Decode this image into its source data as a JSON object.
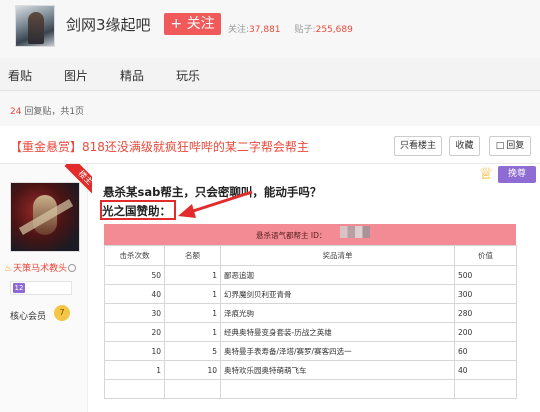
{
  "forum": {
    "name": "剑网3缘起吧",
    "follow_label": "+ 关注",
    "followers_label": "关注:",
    "followers": "37,881",
    "posts_label": "贴子:",
    "posts": "255,689"
  },
  "tabs": [
    "看贴",
    "图片",
    "精品",
    "玩乐"
  ],
  "reply_info": {
    "count": "24",
    "text": "回复贴，共1页"
  },
  "thread": {
    "title": "【重金悬赏】818还没满级就疯狂哔哔的某二字帮会帮主",
    "buttons": {
      "only_op": "只看楼主",
      "favorite": "收藏",
      "reply": "回复"
    }
  },
  "user": {
    "ribbon": "楼主",
    "name": "天策马术教头",
    "level_badge": "12",
    "member_label": "核心会员",
    "member_level": "7"
  },
  "post": {
    "promote_label": "挽尊",
    "line1": "悬杀某sab帮主，只会密聊叫，能动手吗？",
    "line2": "光之国赞助："
  },
  "prize_table": {
    "header": "悬杀语气都帮主 ID：",
    "columns": [
      "击杀次数",
      "名额",
      "奖品清单",
      "价值"
    ],
    "rows": [
      [
        "50",
        "1",
        "鄙恶追迦",
        "500"
      ],
      [
        "40",
        "1",
        "幻界魔剑贝利亚青骨",
        "300"
      ],
      [
        "30",
        "1",
        "泽痕光驹",
        "280"
      ],
      [
        "20",
        "1",
        "经典奥特曼变身套装-历战之英雄",
        "200"
      ],
      [
        "10",
        "5",
        "奥特曼手表寿备/泽塔/赛罗/赛客四选一",
        "60"
      ],
      [
        "1",
        "10",
        "奥特欢乐园奥特萌萌飞车",
        "40"
      ],
      [
        "",
        "",
        "",
        ""
      ]
    ]
  },
  "colors": {
    "accent": "#e94a3b",
    "follow_button": "#f05a5a",
    "table_header": "#f28b93",
    "annotation": "#e32b2b",
    "promote": "#8f6bd4"
  },
  "icons": [
    "forum-avatar",
    "crown-icon",
    "reply-icon",
    "flame-icon",
    "halo-icon",
    "arrow-annotation"
  ]
}
